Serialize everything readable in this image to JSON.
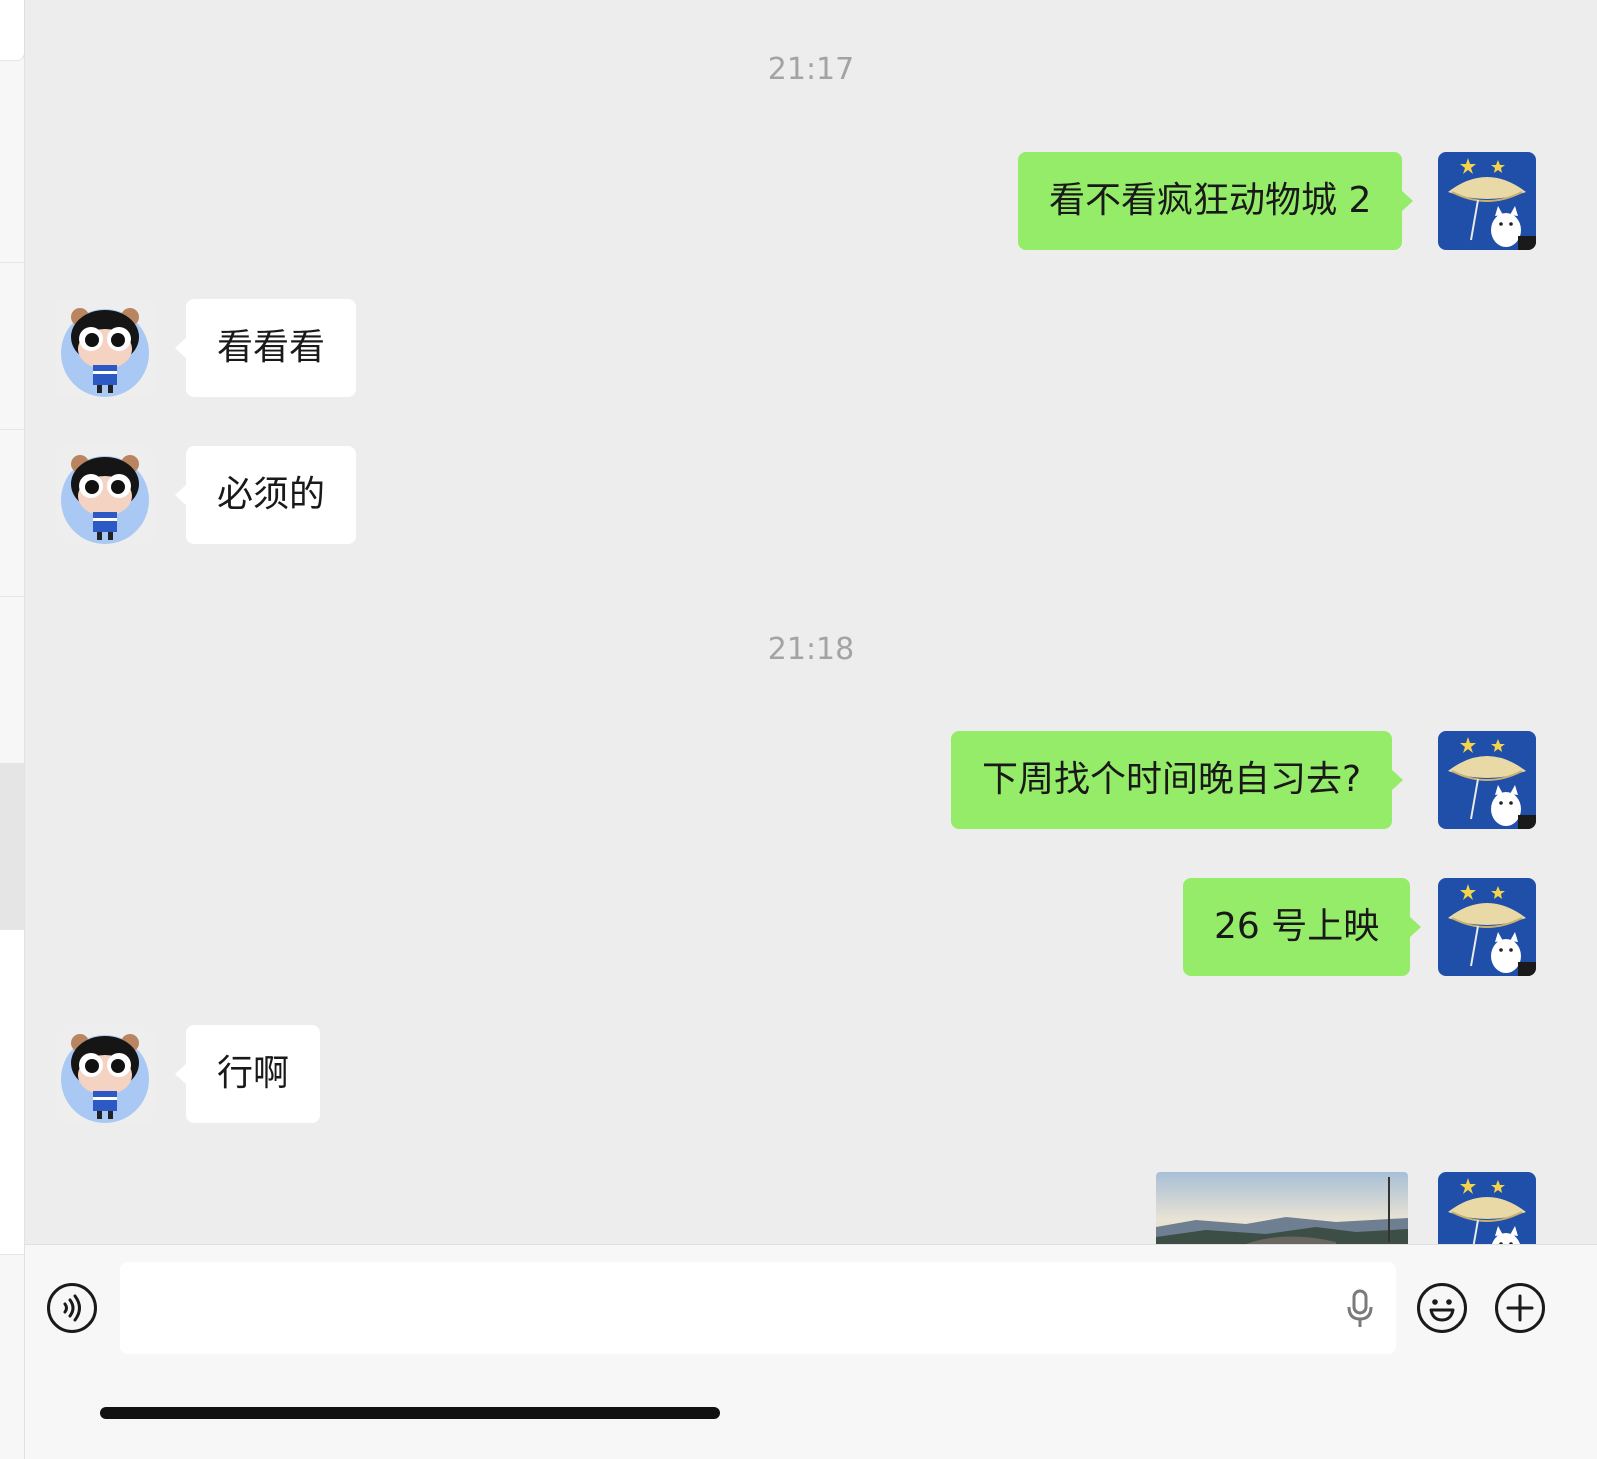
{
  "chat": {
    "timestamps": [
      "21:17",
      "21:18"
    ],
    "messages": [
      {
        "sender": "me",
        "text": "看不看疯狂动物城 2"
      },
      {
        "sender": "other",
        "text": "看看看"
      },
      {
        "sender": "other",
        "text": "必须的"
      },
      {
        "sender": "me",
        "text": "下周找个时间晚自习去?"
      },
      {
        "sender": "me",
        "text": "26 号上映"
      },
      {
        "sender": "other",
        "text": "行啊"
      },
      {
        "sender": "me",
        "type": "image"
      }
    ]
  },
  "input": {
    "placeholder": "",
    "icons": {
      "voice": "voice-toggle-icon",
      "mic": "microphone-icon",
      "emoji": "emoji-icon",
      "more": "plus-icon"
    }
  },
  "colors": {
    "background": "#ededed",
    "my_bubble": "#95ec69",
    "other_bubble": "#ffffff",
    "timestamp": "#a3a3a3"
  }
}
